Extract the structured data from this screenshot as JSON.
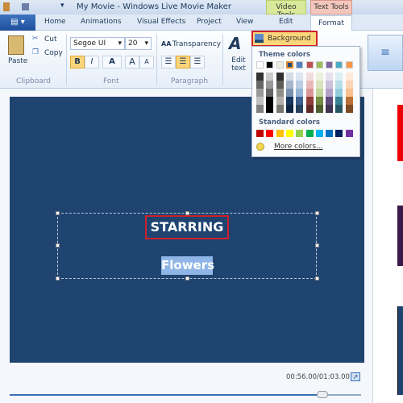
{
  "window": {
    "title": "My Movie - Windows Live Movie Maker"
  },
  "contextual_tabs": {
    "video_tools": "Video Tools",
    "text_tools": "Text Tools"
  },
  "tabs": [
    "Home",
    "Animations",
    "Visual Effects",
    "Project",
    "View",
    "Edit",
    "Format"
  ],
  "active_tab": "Format",
  "ribbon": {
    "clipboard": {
      "paste": "Paste",
      "cut": "Cut",
      "copy": "Copy",
      "label": "Clipboard"
    },
    "font": {
      "family": "Segoe UI",
      "size": "20",
      "bold": "B",
      "italic": "I",
      "color": "A",
      "grow": "A",
      "shrink": "A",
      "label": "Font"
    },
    "paragraph": {
      "transparency": "Transparency",
      "label": "Paragraph",
      "alignment": "center"
    },
    "edit_text": "Edit text",
    "background_color": "Background color"
  },
  "color_menu": {
    "theme_label": "Theme colors",
    "theme_colors": [
      "#ffffff",
      "#000000",
      "#eeece1",
      "#1f497d",
      "#4f81bd",
      "#c0504d",
      "#9bbb59",
      "#8064a2",
      "#4bacc6",
      "#f79646"
    ],
    "selected_color": "#1f497d",
    "standard_label": "Standard colors",
    "standard_colors": [
      "#c00000",
      "#ff0000",
      "#ffc000",
      "#ffff00",
      "#92d050",
      "#00b050",
      "#00b0f0",
      "#0070c0",
      "#002060",
      "#7030a0"
    ],
    "more_colors": "More colors..."
  },
  "preview": {
    "background": "#1f4470",
    "line1": "STARRING",
    "line2": "Flowers",
    "time": "00:56.00/01:03.00",
    "progress": 0.89
  }
}
